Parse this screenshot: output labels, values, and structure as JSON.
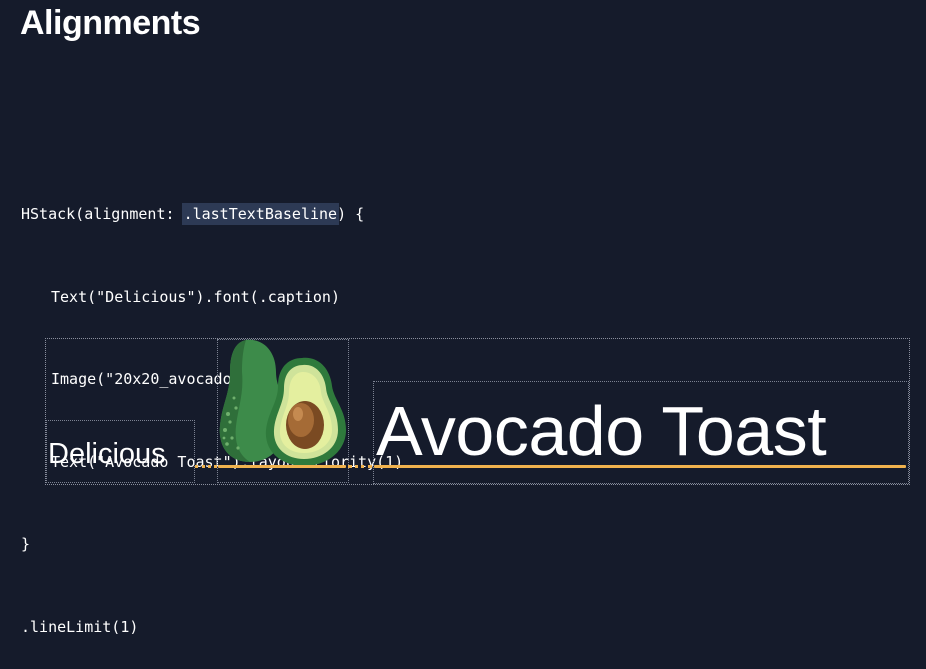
{
  "title": "Alignments",
  "code": {
    "line1_pre": "HStack(alignment: ",
    "line1_hl": ".lastTextBaseline",
    "line1_post": ") {",
    "line2": "Text(\"Delicious\").font(.caption)",
    "line3": "Image(\"20x20_avocado\")",
    "line4": "Text(\"Avocado Toast\").layoutPriority(1)",
    "line5": "}",
    "line6": ".lineLimit(1)"
  },
  "demo": {
    "caption_text": "Delicious",
    "main_text": "Avocado Toast",
    "image_icon": "avocado-icon"
  },
  "colors": {
    "background": "#151b2b",
    "highlight": "#2d3a55",
    "baseline": "#f0b24e",
    "text": "#ffffff",
    "guide": "#7c8292"
  }
}
